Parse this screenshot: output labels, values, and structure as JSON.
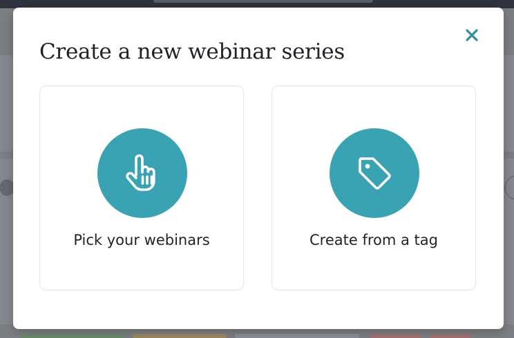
{
  "modal": {
    "title": "Create a new webinar series",
    "close_icon": "close-icon",
    "options": [
      {
        "label": "Pick your webinars",
        "icon": "pointer-hand-icon"
      },
      {
        "label": "Create from a tag",
        "icon": "tag-icon"
      }
    ]
  },
  "colors": {
    "accent": "#3aa3b3",
    "close": "#2f8e9d",
    "overlay": "#7d7f84",
    "text": "#1f2228",
    "card_border": "#e4e4e7"
  }
}
